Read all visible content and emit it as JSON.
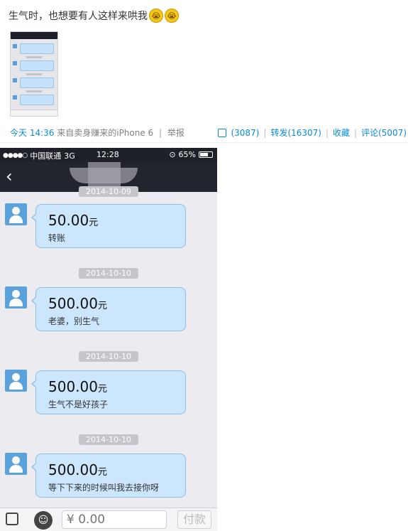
{
  "post": {
    "text": "生气时，也想要有人这样来哄我",
    "emoji": [
      "😭",
      "😭"
    ],
    "time": "今天 14:36",
    "source": "来自卖身赚来的iPhone 6",
    "report": "举报",
    "likes": "(3087)",
    "repost": "转发(16307)",
    "favorite": "收藏",
    "comment": "评论(5007)"
  },
  "statusbar": {
    "signal": "●●●●○",
    "carrier": "中国联通",
    "network": "3G",
    "time": "12:28",
    "battery": "65%"
  },
  "chat": {
    "first_date_partial": "2014-10-09",
    "messages": [
      {
        "amount": "50.00",
        "unit": "元",
        "note": "转账"
      },
      {
        "date": "2014-10-10",
        "amount": "500.00",
        "unit": "元",
        "note": "老婆，别生气"
      },
      {
        "date": "2014-10-10",
        "amount": "500.00",
        "unit": "元",
        "note": "生气不是好孩子"
      },
      {
        "date": "2014-10-10",
        "amount": "500.00",
        "unit": "元",
        "note": "等下下来的时候叫我去接你呀"
      }
    ]
  },
  "input": {
    "placeholder": "¥ 0.00",
    "pay_label": "付款"
  }
}
